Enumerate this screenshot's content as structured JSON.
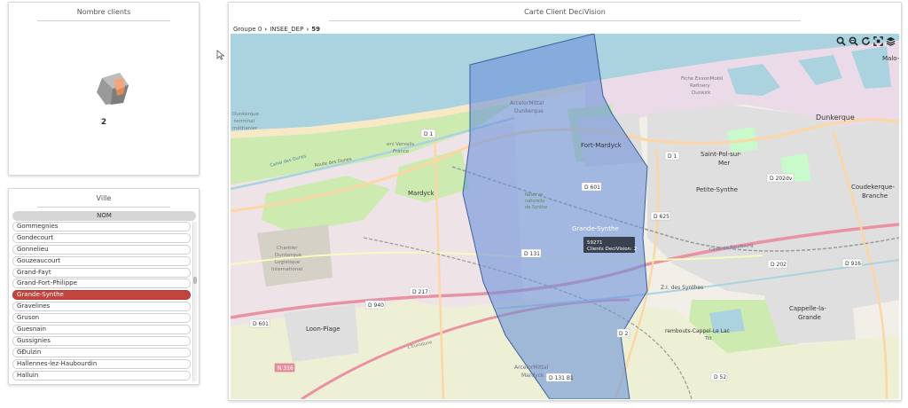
{
  "kpi_panel": {
    "title": "Nombre clients",
    "value": "2"
  },
  "ville_panel": {
    "title": "Ville",
    "column_header": "NOM",
    "items": [
      {
        "label": "Gommegnies",
        "selected": false
      },
      {
        "label": "Gondecourt",
        "selected": false
      },
      {
        "label": "Gonnelieu",
        "selected": false
      },
      {
        "label": "Gouzeaucourt",
        "selected": false
      },
      {
        "label": "Grand-Fayt",
        "selected": false
      },
      {
        "label": "Grand-Fort-Philippe",
        "selected": false
      },
      {
        "label": "Grande-Synthe",
        "selected": true
      },
      {
        "label": "Gravelines",
        "selected": false
      },
      {
        "label": "Gruson",
        "selected": false
      },
      {
        "label": "Guesnain",
        "selected": false
      },
      {
        "label": "Gussignies",
        "selected": false
      },
      {
        "label": "GÐulzin",
        "selected": false
      },
      {
        "label": "Hallennes-lez-Haubourdin",
        "selected": false
      },
      {
        "label": "Halluin",
        "selected": false
      }
    ]
  },
  "map_panel": {
    "title": "Carte Client DeciVision",
    "breadcrumb": [
      "Groupe 0",
      "INSEE_DEP",
      "59"
    ],
    "tooltip": {
      "line1": "59271",
      "line2": "Clients DeciVision: 2"
    },
    "labels": {
      "fort_mardyck": "Fort-Mardyck",
      "mardyck": "Mardyck",
      "grande_synthe": "Grande-Synthe",
      "saint_pol": "Saint-Pol-sur-",
      "saint_pol2": "Mer",
      "petite_synthe": "Petite-Synthe",
      "dunkerque": "Dunkerque",
      "coudekerque": "Coudekerque-",
      "coudekerque2": "Branche",
      "loon_plage": "Loon-Plage",
      "cappelle": "Cappelle-la-",
      "cappelle2": "Grande",
      "malo": "Malo-",
      "arcelor": "ArcelorMittal",
      "arcelor2": "Dunkerque",
      "arcelor3": "ArcelorMittal",
      "arcelor4": "Mardyck",
      "chantier": "Chantier",
      "chantier2": "Dunkerque",
      "chantier3": "Logistique",
      "chantier4": "International",
      "versalis": "eni Versalis",
      "versalis2": "France",
      "route_dunes": "Route des Dunes",
      "canal_dunes": "Canal des Dunes",
      "dunkerque_term": "Dunkerque",
      "dunkerque_term2": "terminal",
      "dunkerque_term3": "méthanier",
      "exxon": "Fiche ExxonMobil",
      "exxon2": "Refinery",
      "exxon3": "Dunkirk",
      "za_synthes": "Z.I. des Synthes",
      "rembouts": "rembouts-Cappel-Le Lac",
      "rembouts2": "Tilt",
      "reserve": "Réserve",
      "reserve2": "naturelle",
      "reserve3": "de Synthe",
      "eurodune": "L'Eurodune",
      "canal_bourbourg": "Canal de Bourbourg",
      "road_d1": "D 1",
      "road_d1b": "D 1",
      "road_d601": "D 601",
      "road_d601b": "D 601",
      "road_d131": "D 131",
      "road_d217": "D 217",
      "road_d940": "D 940",
      "road_d625": "D 625",
      "road_d202": "D 202",
      "road_d202dv": "D 202dv",
      "road_d916": "D 916",
      "road_d52": "D 52",
      "road_d2": "D 2",
      "road_d131b1": "D 131 B1",
      "road_n316": "N 316"
    }
  },
  "colors": {
    "accent_selected": "#c0463d",
    "polygon_fill": "#6c93db",
    "sea": "#aad3df",
    "urban": "#e0dfdf",
    "industrial": "#ebdbe8",
    "park": "#c8facc",
    "grass": "#cdebb0",
    "road_primary": "#fcd6a4",
    "road_trunk": "#f9b29c"
  },
  "icons": [
    "cube-icon",
    "zoom-in-icon",
    "zoom-out-icon",
    "refresh-icon",
    "fullscreen-icon",
    "layers-icon"
  ]
}
